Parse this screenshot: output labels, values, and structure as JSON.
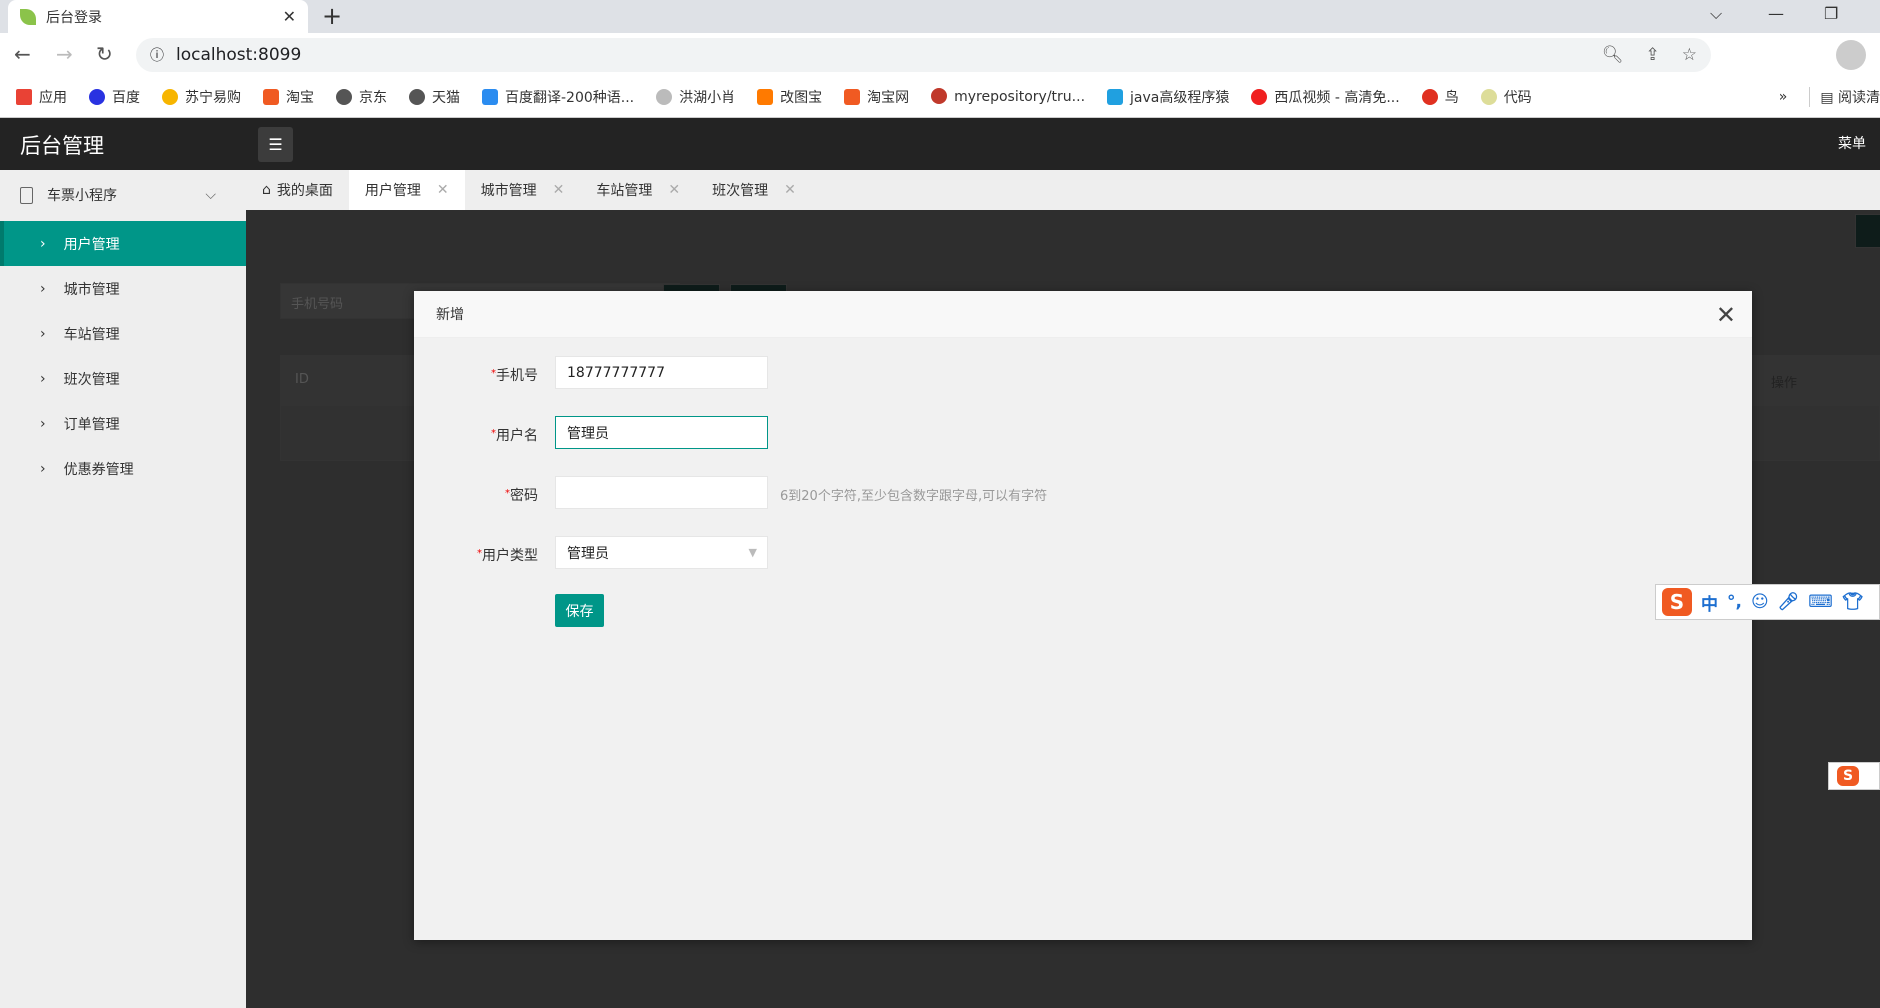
{
  "browser": {
    "tab_title": "后台登录",
    "url": "localhost:8099",
    "bookmarks": [
      {
        "label": "应用",
        "color": "#e94235"
      },
      {
        "label": "百度",
        "color": "#2932e1"
      },
      {
        "label": "苏宁易购",
        "color": "#f7b500"
      },
      {
        "label": "淘宝",
        "color": "#f05a22"
      },
      {
        "label": "京东",
        "color": "#555555"
      },
      {
        "label": "天猫",
        "color": "#555555"
      },
      {
        "label": "百度翻译-200种语...",
        "color": "#2b8cf0"
      },
      {
        "label": "洪湖小肖",
        "color": "#999999"
      },
      {
        "label": "改图宝",
        "color": "#ff7a00"
      },
      {
        "label": "淘宝网",
        "color": "#f05a22"
      },
      {
        "label": "myrepository/tru...",
        "color": "#c0392b"
      },
      {
        "label": "java高级程序猿",
        "color": "#20a0e0"
      },
      {
        "label": "西瓜视频 - 高清免...",
        "color": "#f02020"
      },
      {
        "label": "鸟",
        "color": "#e03020"
      },
      {
        "label": "代码",
        "color": "#dddd99"
      }
    ],
    "more": "»",
    "reading_list": "阅读清"
  },
  "app": {
    "title": "后台管理",
    "menu": "菜单",
    "accent": "#009688"
  },
  "sidebar": {
    "group": "车票小程序",
    "items": [
      {
        "label": "用户管理"
      },
      {
        "label": "城市管理"
      },
      {
        "label": "车站管理"
      },
      {
        "label": "班次管理"
      },
      {
        "label": "订单管理"
      },
      {
        "label": "优惠券管理"
      }
    ]
  },
  "tabs": [
    {
      "label": "我的桌面"
    },
    {
      "label": "用户管理"
    },
    {
      "label": "城市管理"
    },
    {
      "label": "车站管理"
    },
    {
      "label": "班次管理"
    }
  ],
  "background": {
    "search_placeholder": "手机号码",
    "col_id": "ID",
    "col_action": "操作"
  },
  "modal": {
    "title": "新增",
    "fields": {
      "phone_label": "手机号",
      "phone_value": "18777777777",
      "username_label": "用户名",
      "username_value": "管理员",
      "password_label": "密码",
      "password_value": "",
      "password_hint": "6到20个字符,至少包含数字跟字母,可以有字符",
      "type_label": "用户类型",
      "type_value": "管理员"
    },
    "save": "保存"
  },
  "ime": {
    "mode": "中",
    "punct": "°,"
  }
}
